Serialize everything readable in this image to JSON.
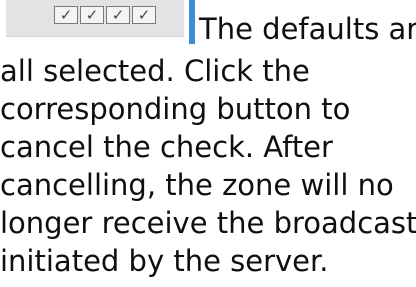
{
  "checkboxes": [
    {
      "state": "checked",
      "glyph": "✓"
    },
    {
      "state": "checked",
      "glyph": "✓"
    },
    {
      "state": "checked",
      "glyph": "✓"
    },
    {
      "state": "checked",
      "glyph": "✓"
    }
  ],
  "colors": {
    "accent_bar": "#3a8fd6",
    "strip_bg": "#e3e3e3",
    "text": "#0f0f0f"
  },
  "paragraph": {
    "lines": [
      "The defaults are",
      "all selected. Click the",
      "corresponding button to",
      "cancel the check. After",
      "cancelling, the zone will no",
      "longer receive the broadcast",
      "initiated by the server."
    ]
  }
}
